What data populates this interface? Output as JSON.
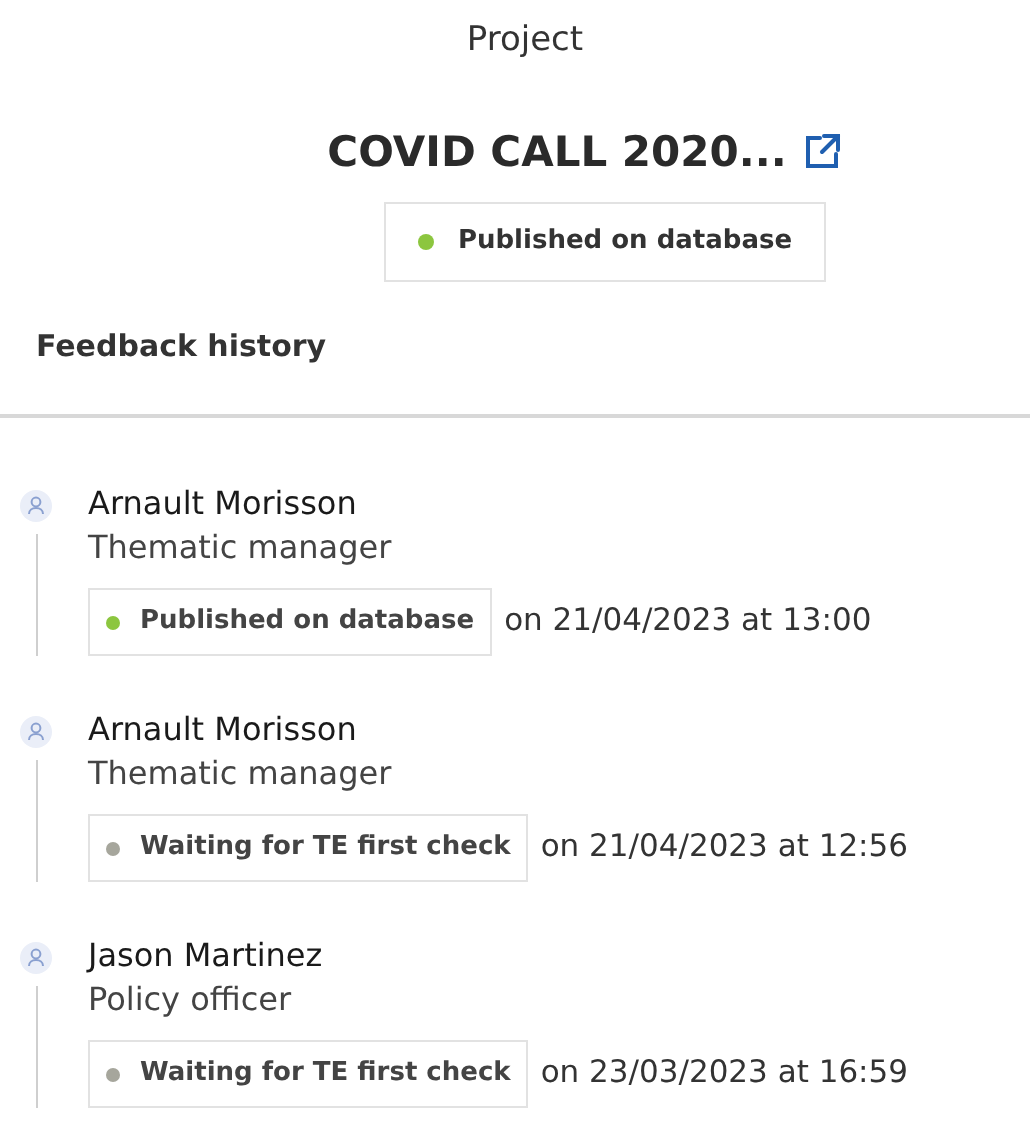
{
  "header": {
    "label": "Project",
    "title": "COVID CALL 2020...",
    "status": {
      "text": "Published on database",
      "color": "#8cc63f"
    }
  },
  "feedback_history": {
    "heading": "Feedback history",
    "entries": [
      {
        "name": "Arnault Morisson",
        "role": "Thematic manager",
        "status": {
          "text": "Published on database",
          "color": "#8cc63f"
        },
        "date": "on 21/04/2023 at 13:00"
      },
      {
        "name": "Arnault Morisson",
        "role": "Thematic manager",
        "status": {
          "text": "Waiting for TE first check",
          "color": "#a6a69c"
        },
        "date": "on 21/04/2023 at 12:56"
      },
      {
        "name": "Jason Martinez",
        "role": "Policy officer",
        "status": {
          "text": "Waiting for TE first check",
          "color": "#a6a69c"
        },
        "date": "on 23/03/2023 at 16:59"
      }
    ]
  }
}
